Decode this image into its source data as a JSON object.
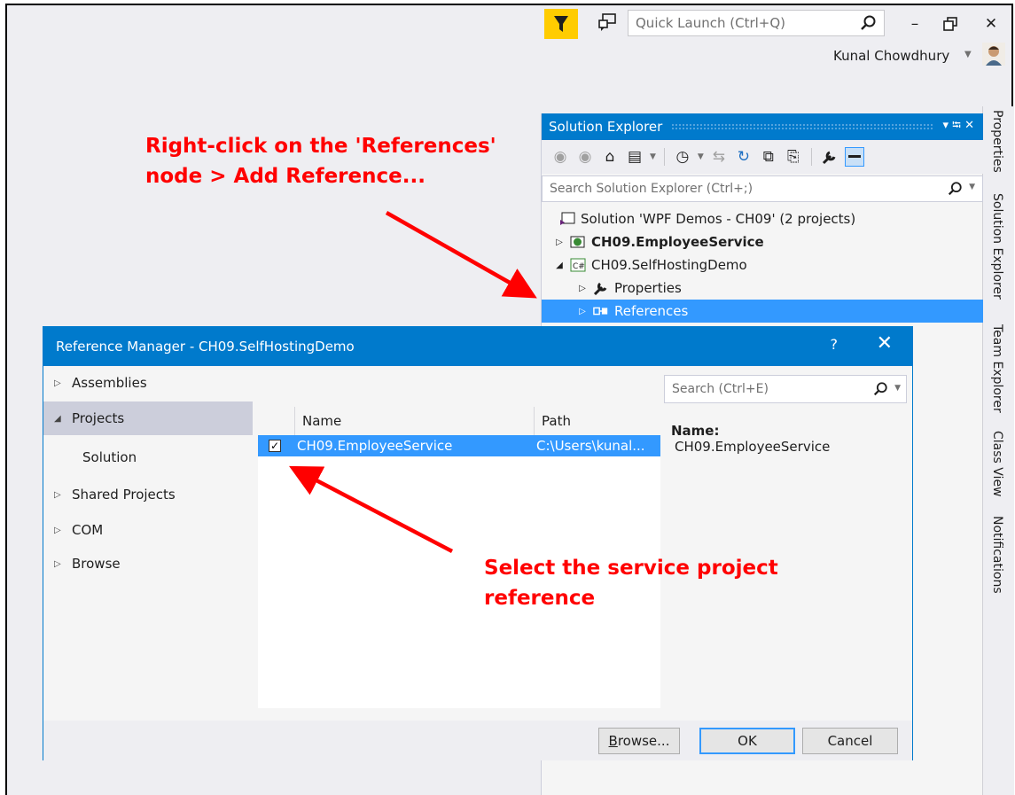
{
  "titlebar": {
    "quick_launch_placeholder": "Quick Launch (Ctrl+Q)",
    "user_name": "Kunal Chowdhury",
    "minimize": "–",
    "restore": "❐",
    "close": "✕"
  },
  "side_tabs": [
    "Properties",
    "Solution Explorer",
    "Team Explorer",
    "Class View",
    "Notifications"
  ],
  "solution_explorer": {
    "title": "Solution Explorer",
    "title_controls": "▾ ⭾ ✕",
    "search_placeholder": "Search Solution Explorer (Ctrl+;)",
    "tree": [
      {
        "label": "Solution 'WPF Demos - CH09' (2 projects)",
        "icon": "solution-icon"
      },
      {
        "label": "CH09.EmployeeService",
        "icon": "web-project-icon"
      },
      {
        "label": "CH09.SelfHostingDemo",
        "icon": "csharp-project-icon"
      },
      {
        "label": "Properties",
        "icon": "wrench-icon"
      },
      {
        "label": "References",
        "icon": "references-icon"
      }
    ]
  },
  "dialog": {
    "title": "Reference Manager - CH09.SelfHostingDemo",
    "help": "?",
    "close": "✕",
    "nav": [
      "Assemblies",
      "Projects",
      "Solution",
      "Shared Projects",
      "COM",
      "Browse"
    ],
    "search_placeholder": "Search (Ctrl+E)",
    "columns": [
      "Name",
      "Path"
    ],
    "rows": [
      {
        "name": "CH09.EmployeeService",
        "path": "C:\\Users\\kunal...",
        "checked": true
      }
    ],
    "detail_label": "Name:",
    "detail_value": "CH09.EmployeeService",
    "buttons": {
      "browse_prefix": "B",
      "browse_rest": "rowse...",
      "ok": "OK",
      "cancel": "Cancel"
    }
  },
  "annotations": {
    "top_line1": "Right-click on the 'References'",
    "top_line2": "node > Add Reference...",
    "bottom_line1": "Select the service project",
    "bottom_line2": "reference",
    "color": "#ff0000"
  }
}
